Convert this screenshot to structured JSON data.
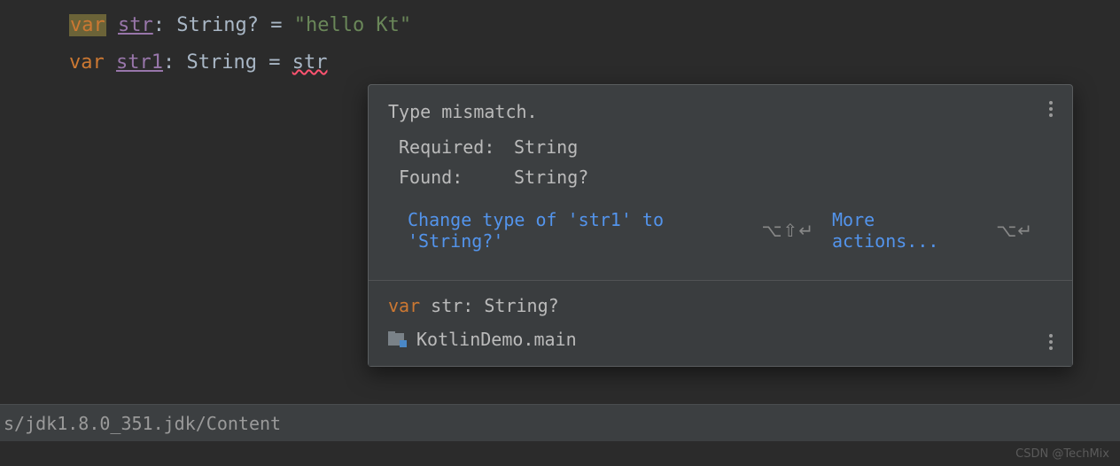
{
  "code": {
    "line1": {
      "kw": "var",
      "name": "str",
      "type": "String?",
      "eq": "=",
      "val": "\"hello Kt\""
    },
    "line2": {
      "kw": "var",
      "name": "str1",
      "type": "String",
      "eq": "=",
      "rhs": "str"
    }
  },
  "tooltip": {
    "title": "Type mismatch.",
    "required_label": "Required:",
    "required_value": "String",
    "found_label": "Found:",
    "found_value": "String?",
    "fix_link": "Change type of 'str1' to 'String?'",
    "fix_shortcut": "⌥⇧↵",
    "more_link": "More actions...",
    "more_shortcut": "⌥↵",
    "decl": {
      "kw": "var",
      "name": "str",
      "type": "String?"
    },
    "location": "KotlinDemo.main"
  },
  "status": "s/jdk1.8.0_351.jdk/Content",
  "watermark": "CSDN @TechMix"
}
